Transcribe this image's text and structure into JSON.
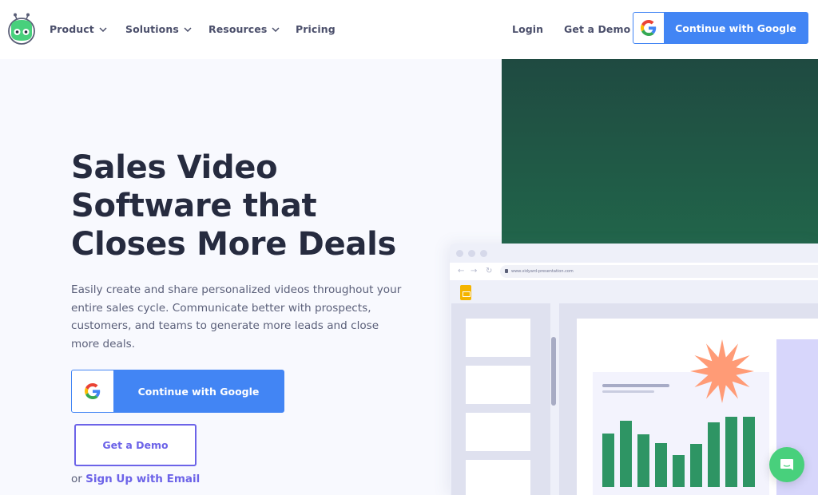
{
  "header": {
    "logo": "vidyard-robot-logo",
    "nav": [
      {
        "label": "Product",
        "has_dropdown": true
      },
      {
        "label": "Solutions",
        "has_dropdown": true
      },
      {
        "label": "Resources",
        "has_dropdown": true
      },
      {
        "label": "Pricing",
        "has_dropdown": false
      }
    ],
    "login_label": "Login",
    "demo_label": "Get a Demo",
    "google_button_label": "Continue with Google"
  },
  "hero": {
    "title_lines": [
      "Sales Video",
      "Software that",
      "Closes More Deals"
    ],
    "description": "Easily create and share personalized videos throughout your entire sales cycle. Communicate better with prospects, customers, and teams to generate more leads and close more deals.",
    "google_button_label": "Continue with Google",
    "demo_button_label": "Get a Demo",
    "signup_prefix": "or",
    "signup_link_label": "Sign Up with Email"
  },
  "illustration": {
    "url": "www.vidyard-presentation.com",
    "thumbnail_count": 4,
    "bar_values": [
      0.61,
      0.75,
      0.6,
      0.5,
      0.36,
      0.49,
      0.74,
      0.8,
      0.8
    ]
  },
  "colors": {
    "google_blue": "#4285f4",
    "accent_purple": "#6c63e8",
    "brand_green": "#48d07c",
    "bar_green": "#2e9564",
    "starburst": "#ff9b76"
  },
  "chat": {
    "icon": "chat-icon"
  }
}
